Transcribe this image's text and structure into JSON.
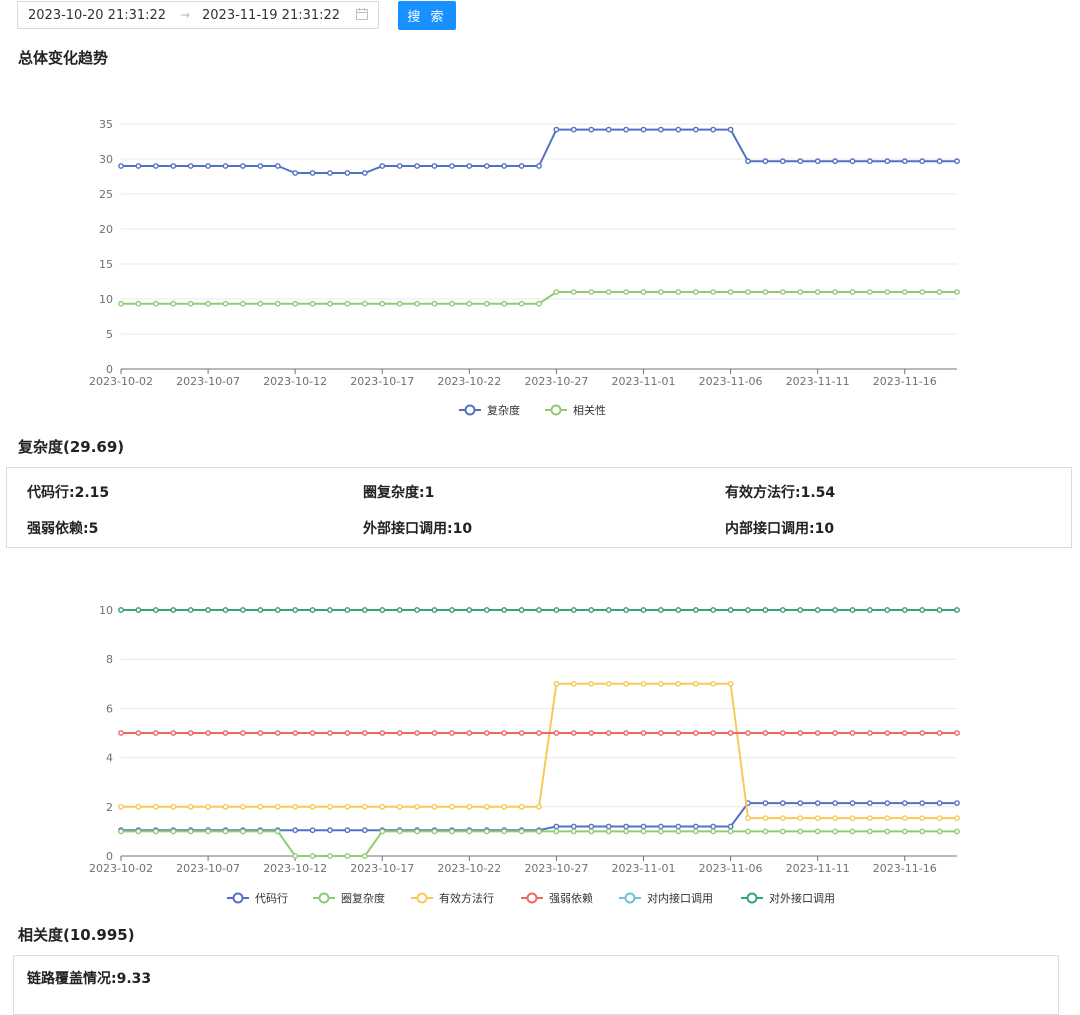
{
  "filter": {
    "start_date": "2023-10-20 21:31:22",
    "end_date": "2023-11-19 21:31:22",
    "separator": "→",
    "search_label": "搜 索"
  },
  "overall": {
    "title": "总体变化趋势"
  },
  "complexity": {
    "title": "复杂度(29.69)",
    "metrics": [
      {
        "label": "代码行:2.15"
      },
      {
        "label": "圈复杂度:1"
      },
      {
        "label": "有效方法行:1.54"
      },
      {
        "label": "强弱依赖:5"
      },
      {
        "label": "外部接口调用:10"
      },
      {
        "label": "内部接口调用:10"
      }
    ]
  },
  "correlation": {
    "title": "相关度(10.995)",
    "metrics": [
      {
        "label": "链路覆盖情况:9.33"
      }
    ]
  },
  "chart_data": [
    {
      "type": "line",
      "x": [
        "2023-10-02",
        "2023-10-03",
        "2023-10-04",
        "2023-10-05",
        "2023-10-06",
        "2023-10-07",
        "2023-10-08",
        "2023-10-09",
        "2023-10-10",
        "2023-10-11",
        "2023-10-12",
        "2023-10-13",
        "2023-10-14",
        "2023-10-15",
        "2023-10-16",
        "2023-10-17",
        "2023-10-18",
        "2023-10-19",
        "2023-10-20",
        "2023-10-21",
        "2023-10-22",
        "2023-10-23",
        "2023-10-24",
        "2023-10-25",
        "2023-10-26",
        "2023-10-27",
        "2023-10-28",
        "2023-10-29",
        "2023-10-30",
        "2023-10-31",
        "2023-11-01",
        "2023-11-02",
        "2023-11-03",
        "2023-11-04",
        "2023-11-05",
        "2023-11-06",
        "2023-11-07",
        "2023-11-08",
        "2023-11-09",
        "2023-11-10",
        "2023-11-11",
        "2023-11-12",
        "2023-11-13",
        "2023-11-14",
        "2023-11-15",
        "2023-11-16",
        "2023-11-17",
        "2023-11-18",
        "2023-11-19"
      ],
      "xticks": [
        "2023-10-02",
        "2023-10-07",
        "2023-10-12",
        "2023-10-17",
        "2023-10-22",
        "2023-10-27",
        "2023-11-01",
        "2023-11-06",
        "2023-11-11",
        "2023-11-16"
      ],
      "ylim": [
        0,
        35
      ],
      "yticks": [
        0,
        5,
        10,
        15,
        20,
        25,
        30,
        35
      ],
      "grid": true,
      "legend_position": "bottom",
      "series": [
        {
          "name": "复杂度",
          "color": "#5470c6",
          "values": [
            29,
            29,
            29,
            29,
            29,
            29,
            29,
            29,
            29,
            29,
            28,
            28,
            28,
            28,
            28,
            29,
            29,
            29,
            29,
            29,
            29,
            29,
            29,
            29,
            29,
            34.2,
            34.2,
            34.2,
            34.2,
            34.2,
            34.2,
            34.2,
            34.2,
            34.2,
            34.2,
            34.2,
            29.69,
            29.69,
            29.69,
            29.69,
            29.69,
            29.69,
            29.69,
            29.69,
            29.69,
            29.69,
            29.69,
            29.69,
            29.69
          ]
        },
        {
          "name": "相关性",
          "color": "#91cc75",
          "values": [
            9.33,
            9.33,
            9.33,
            9.33,
            9.33,
            9.33,
            9.33,
            9.33,
            9.33,
            9.33,
            9.33,
            9.33,
            9.33,
            9.33,
            9.33,
            9.33,
            9.33,
            9.33,
            9.33,
            9.33,
            9.33,
            9.33,
            9.33,
            9.33,
            9.33,
            10.995,
            10.995,
            10.995,
            10.995,
            10.995,
            10.995,
            10.995,
            10.995,
            10.995,
            10.995,
            10.995,
            10.995,
            10.995,
            10.995,
            10.995,
            10.995,
            10.995,
            10.995,
            10.995,
            10.995,
            10.995,
            10.995,
            10.995,
            10.995
          ]
        }
      ]
    },
    {
      "type": "line",
      "x": [
        "2023-10-02",
        "2023-10-03",
        "2023-10-04",
        "2023-10-05",
        "2023-10-06",
        "2023-10-07",
        "2023-10-08",
        "2023-10-09",
        "2023-10-10",
        "2023-10-11",
        "2023-10-12",
        "2023-10-13",
        "2023-10-14",
        "2023-10-15",
        "2023-10-16",
        "2023-10-17",
        "2023-10-18",
        "2023-10-19",
        "2023-10-20",
        "2023-10-21",
        "2023-10-22",
        "2023-10-23",
        "2023-10-24",
        "2023-10-25",
        "2023-10-26",
        "2023-10-27",
        "2023-10-28",
        "2023-10-29",
        "2023-10-30",
        "2023-10-31",
        "2023-11-01",
        "2023-11-02",
        "2023-11-03",
        "2023-11-04",
        "2023-11-05",
        "2023-11-06",
        "2023-11-07",
        "2023-11-08",
        "2023-11-09",
        "2023-11-10",
        "2023-11-11",
        "2023-11-12",
        "2023-11-13",
        "2023-11-14",
        "2023-11-15",
        "2023-11-16",
        "2023-11-17",
        "2023-11-18",
        "2023-11-19"
      ],
      "xticks": [
        "2023-10-02",
        "2023-10-07",
        "2023-10-12",
        "2023-10-17",
        "2023-10-22",
        "2023-10-27",
        "2023-11-01",
        "2023-11-06",
        "2023-11-11",
        "2023-11-16"
      ],
      "ylim": [
        0,
        10
      ],
      "yticks": [
        0,
        2,
        4,
        6,
        8,
        10
      ],
      "grid": true,
      "legend_position": "bottom",
      "series": [
        {
          "name": "代码行",
          "color": "#5470c6",
          "values": [
            1.05,
            1.05,
            1.05,
            1.05,
            1.05,
            1.05,
            1.05,
            1.05,
            1.05,
            1.05,
            1.05,
            1.05,
            1.05,
            1.05,
            1.05,
            1.05,
            1.05,
            1.05,
            1.05,
            1.05,
            1.05,
            1.05,
            1.05,
            1.05,
            1.05,
            1.2,
            1.2,
            1.2,
            1.2,
            1.2,
            1.2,
            1.2,
            1.2,
            1.2,
            1.2,
            1.2,
            2.15,
            2.15,
            2.15,
            2.15,
            2.15,
            2.15,
            2.15,
            2.15,
            2.15,
            2.15,
            2.15,
            2.15,
            2.15
          ]
        },
        {
          "name": "圈复杂度",
          "color": "#91cc75",
          "values": [
            1,
            1,
            1,
            1,
            1,
            1,
            1,
            1,
            1,
            1,
            0,
            0,
            0,
            0,
            0,
            1,
            1,
            1,
            1,
            1,
            1,
            1,
            1,
            1,
            1,
            1,
            1,
            1,
            1,
            1,
            1,
            1,
            1,
            1,
            1,
            1,
            1,
            1,
            1,
            1,
            1,
            1,
            1,
            1,
            1,
            1,
            1,
            1,
            1
          ]
        },
        {
          "name": "有效方法行",
          "color": "#fac858",
          "values": [
            2,
            2,
            2,
            2,
            2,
            2,
            2,
            2,
            2,
            2,
            2,
            2,
            2,
            2,
            2,
            2,
            2,
            2,
            2,
            2,
            2,
            2,
            2,
            2,
            2,
            7,
            7,
            7,
            7,
            7,
            7,
            7,
            7,
            7,
            7,
            7,
            1.54,
            1.54,
            1.54,
            1.54,
            1.54,
            1.54,
            1.54,
            1.54,
            1.54,
            1.54,
            1.54,
            1.54,
            1.54
          ]
        },
        {
          "name": "强弱依赖",
          "color": "#ee6666",
          "values": [
            5,
            5,
            5,
            5,
            5,
            5,
            5,
            5,
            5,
            5,
            5,
            5,
            5,
            5,
            5,
            5,
            5,
            5,
            5,
            5,
            5,
            5,
            5,
            5,
            5,
            5,
            5,
            5,
            5,
            5,
            5,
            5,
            5,
            5,
            5,
            5,
            5,
            5,
            5,
            5,
            5,
            5,
            5,
            5,
            5,
            5,
            5,
            5,
            5
          ]
        },
        {
          "name": "对内接口调用",
          "color": "#73c0de",
          "values": [
            10,
            10,
            10,
            10,
            10,
            10,
            10,
            10,
            10,
            10,
            10,
            10,
            10,
            10,
            10,
            10,
            10,
            10,
            10,
            10,
            10,
            10,
            10,
            10,
            10,
            10,
            10,
            10,
            10,
            10,
            10,
            10,
            10,
            10,
            10,
            10,
            10,
            10,
            10,
            10,
            10,
            10,
            10,
            10,
            10,
            10,
            10,
            10,
            10
          ]
        },
        {
          "name": "对外接口调用",
          "color": "#3ba272",
          "values": [
            10,
            10,
            10,
            10,
            10,
            10,
            10,
            10,
            10,
            10,
            10,
            10,
            10,
            10,
            10,
            10,
            10,
            10,
            10,
            10,
            10,
            10,
            10,
            10,
            10,
            10,
            10,
            10,
            10,
            10,
            10,
            10,
            10,
            10,
            10,
            10,
            10,
            10,
            10,
            10,
            10,
            10,
            10,
            10,
            10,
            10,
            10,
            10,
            10
          ]
        }
      ]
    }
  ]
}
